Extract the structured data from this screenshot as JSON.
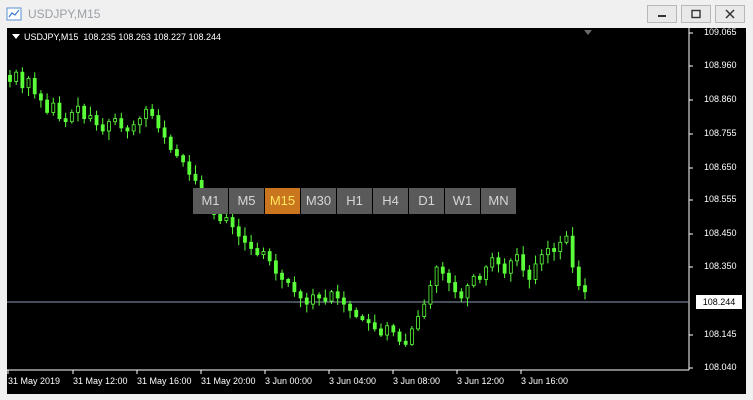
{
  "window": {
    "title": "USDJPY,M15",
    "icon": "chart-window-icon",
    "controls": [
      "minimize-icon",
      "restore-icon",
      "close-icon"
    ]
  },
  "chart_info": {
    "symbol": "USDJPY,M15",
    "ohlc": "108.235 108.263 108.227 108.244"
  },
  "timeframes": {
    "items": [
      "M1",
      "M5",
      "M15",
      "M30",
      "H1",
      "H4",
      "D1",
      "W1",
      "MN"
    ],
    "active": "M15"
  },
  "colors": {
    "background": "#000000",
    "candles": "#5aff3a",
    "grid_text": "#ffffff",
    "bid_line": "#8a9bb3",
    "active_timeframe": "#c9761e"
  },
  "current_price": "108.244",
  "chart_data": {
    "type": "candlestick",
    "ylim": [
      108.0,
      109.08
    ],
    "y_ticks": [
      "109.065",
      "108.960",
      "108.860",
      "108.755",
      "108.650",
      "108.555",
      "108.450",
      "108.350",
      "108.244",
      "108.145",
      "108.040"
    ],
    "x_ticks": [
      "31 May 2019",
      "31 May 12:00",
      "31 May 16:00",
      "31 May 20:00",
      "3 Jun 00:00",
      "3 Jun 04:00",
      "3 Jun 08:00",
      "3 Jun 12:00",
      "3 Jun 16:00"
    ],
    "close_series": [
      108.92,
      108.95,
      108.9,
      108.93,
      108.88,
      108.86,
      108.82,
      108.85,
      108.8,
      108.79,
      108.82,
      108.84,
      108.8,
      108.81,
      108.78,
      108.76,
      108.79,
      108.8,
      108.77,
      108.76,
      108.78,
      108.8,
      108.83,
      108.81,
      108.77,
      108.74,
      108.7,
      108.68,
      108.66,
      108.62,
      108.6,
      108.56,
      108.52,
      108.49,
      108.47,
      108.48,
      108.45,
      108.42,
      108.4,
      108.38,
      108.36,
      108.37,
      108.34,
      108.3,
      108.28,
      108.27,
      108.24,
      108.22,
      108.2,
      108.23,
      108.22,
      108.21,
      108.24,
      108.22,
      108.2,
      108.18,
      108.16,
      108.15,
      108.14,
      108.12,
      108.1,
      108.13,
      108.11,
      108.08,
      108.07,
      108.12,
      108.16,
      108.2,
      108.26,
      108.32,
      108.3,
      108.27,
      108.24,
      108.22,
      108.26,
      108.29,
      108.28,
      108.32,
      108.35,
      108.33,
      108.3,
      108.34,
      108.36,
      108.31,
      108.28,
      108.33,
      108.36,
      108.38,
      108.37,
      108.4,
      108.42,
      108.32,
      108.26,
      108.24
    ]
  }
}
